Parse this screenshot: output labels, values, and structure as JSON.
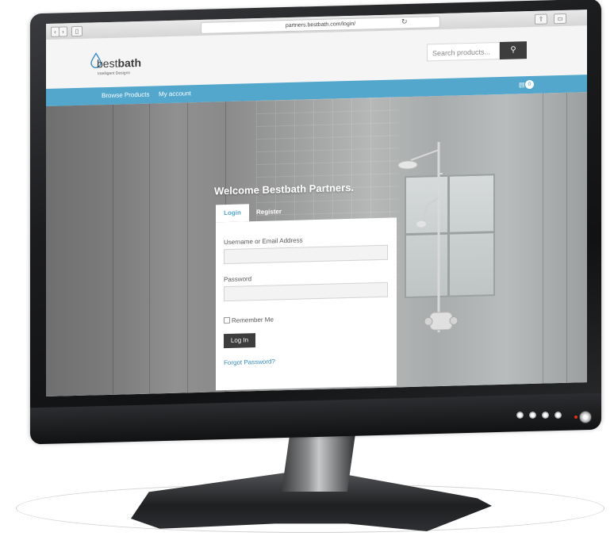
{
  "browser": {
    "url": "partners.bestbath.com/login/",
    "back_icon": "chevron-left",
    "forward_icon": "chevron-right",
    "reload_icon": "reload",
    "share_icon": "share",
    "tabs_icon": "tabs"
  },
  "header": {
    "logo_prefix": "best",
    "logo_suffix": "bath",
    "logo_tagline": "Intelligent Designs",
    "search_placeholder": "Search products...",
    "search_icon": "search"
  },
  "nav": {
    "items": [
      {
        "label": "Browse Products"
      },
      {
        "label": "My account"
      }
    ],
    "cart_count": "0"
  },
  "login": {
    "heading": "Welcome Bestbath Partners.",
    "tabs": [
      {
        "label": "Login",
        "active": true
      },
      {
        "label": "Register",
        "active": false
      }
    ],
    "username_label": "Username or Email Address",
    "username_value": "",
    "password_label": "Password",
    "password_value": "",
    "remember_label": "Remember Me",
    "remember_checked": false,
    "submit_label": "Log In",
    "forgot_label": "Forgot Password?"
  },
  "colors": {
    "accent": "#53a7cd",
    "button_dark": "#3d3d3d",
    "link": "#3a8fc5"
  }
}
